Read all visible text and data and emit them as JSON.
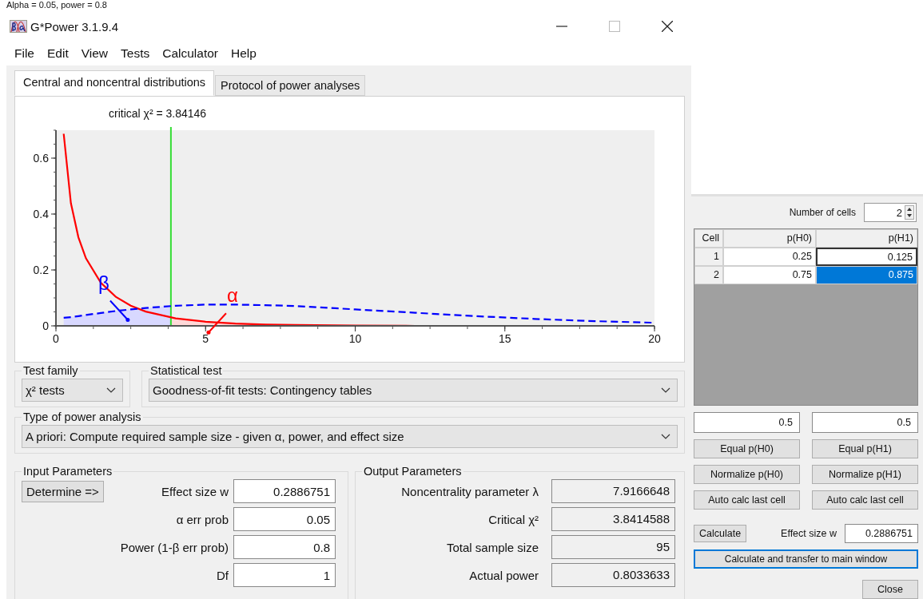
{
  "caption": "Alpha = 0.05, power = 0.8",
  "window": {
    "title": "G*Power 3.1.9.4"
  },
  "menu": [
    "File",
    "Edit",
    "View",
    "Tests",
    "Calculator",
    "Help"
  ],
  "tabs": [
    {
      "label": "Central and noncentral distributions",
      "selected": true
    },
    {
      "label": "Protocol of power analyses",
      "selected": false
    }
  ],
  "plot": {
    "chart_data": {
      "type": "line",
      "title": "critical χ² = 3.84146",
      "x": [
        0.26,
        0.5,
        0.75,
        1,
        1.5,
        2,
        2.5,
        3,
        4,
        5,
        6,
        7,
        8,
        10,
        12,
        14,
        16,
        18,
        20
      ],
      "series": [
        {
          "color": "#ff0000",
          "line_style": "solid",
          "values": [
            0.687,
            0.439,
            0.317,
            0.242,
            0.154,
            0.104,
            0.072,
            0.051,
            0.027,
            0.015,
            0.008,
            0.005,
            0.003,
            0.001,
            0,
            null,
            null,
            null,
            null
          ]
        },
        {
          "color": "#0000ff",
          "line_style": "dashed",
          "values": [
            0.029,
            0.031,
            0.035,
            0.039,
            0.046,
            0.053,
            0.059,
            0.064,
            0.072,
            0.076,
            0.076,
            0.074,
            0.071,
            0.059,
            0.047,
            0.035,
            0.025,
            0.017,
            0.011
          ]
        }
      ],
      "xlim": [
        0,
        20
      ],
      "ylim": [
        0,
        0.7
      ],
      "xticks": [
        0,
        5,
        10,
        15,
        20
      ],
      "yticks": [
        0,
        0.2,
        0.4,
        0.6
      ],
      "ref_lines": [
        {
          "axis": "x",
          "value": 3.84146,
          "color": "#33dd33"
        }
      ],
      "annotations": [
        {
          "text": "β",
          "x": 1.6,
          "y": 0.13
        },
        {
          "text": "α",
          "x": 5.9,
          "y": 0.085
        }
      ]
    }
  },
  "test_family": {
    "label": "Test family",
    "value": "χ² tests"
  },
  "statistical_test": {
    "label": "Statistical test",
    "value": "Goodness-of-fit tests: Contingency tables"
  },
  "type_of_power_analysis": {
    "label": "Type of power analysis",
    "value": "A priori: Compute required sample size - given α, power, and effect size"
  },
  "input_parameters": {
    "title": "Input Parameters",
    "button": "Determine =>",
    "fields": [
      {
        "label": "Effect size w",
        "value": "0.2886751"
      },
      {
        "label": "α err prob",
        "value": "0.05"
      },
      {
        "label": "Power (1-β err prob)",
        "value": "0.8"
      },
      {
        "label": "Df",
        "value": "1"
      }
    ]
  },
  "output_parameters": {
    "title": "Output Parameters",
    "fields": [
      {
        "label": "Noncentrality parameter λ",
        "value": "7.9166648"
      },
      {
        "label": "Critical χ²",
        "value": "3.8414588"
      },
      {
        "label": "Total sample size",
        "value": "95"
      },
      {
        "label": "Actual power",
        "value": "0.8033633"
      }
    ]
  },
  "cells_dialog": {
    "number_of_cells": {
      "label": "Number of cells",
      "value": "2"
    },
    "table": {
      "columns": [
        "Cell",
        "p(H0)",
        "p(H1)"
      ],
      "rows": [
        {
          "cell": "1",
          "p_h0": "0.25",
          "p_h1": "0.125",
          "selected": false
        },
        {
          "cell": "2",
          "p_h0": "0.75",
          "p_h1": "0.875",
          "selected": true
        }
      ]
    },
    "fill_values": [
      "0.5",
      "0.5"
    ],
    "button_rows": [
      [
        "Equal p(H0)",
        "Equal p(H1)"
      ],
      [
        "Normalize p(H0)",
        "Normalize p(H1)"
      ],
      [
        "Auto calc last cell",
        "Auto calc last cell"
      ]
    ],
    "calculate_button": "Calculate",
    "effect_size": {
      "label": "Effect size w",
      "value": "0.2886751"
    },
    "transfer_button": "Calculate and transfer to main window",
    "close_button": "Close"
  }
}
